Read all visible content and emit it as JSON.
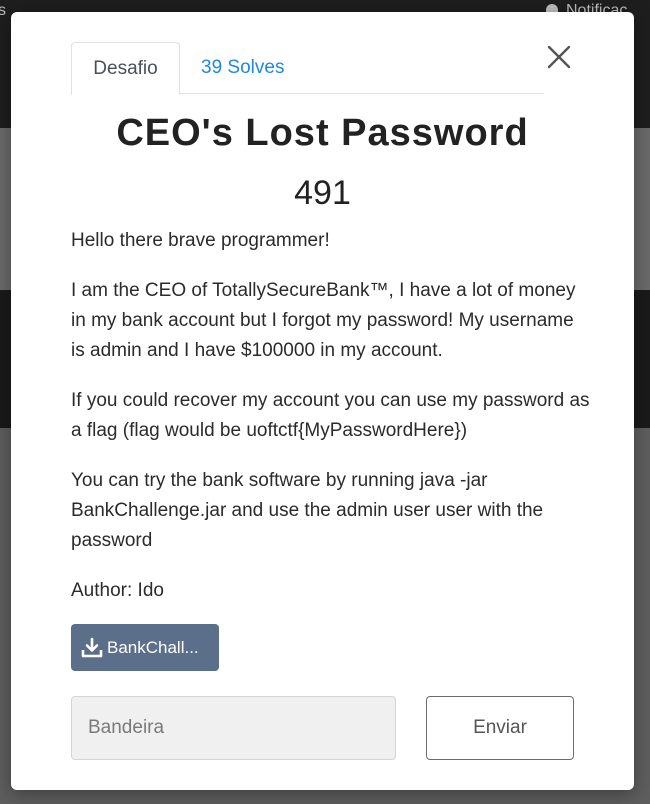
{
  "background": {
    "nav_left": "s",
    "nav_right": "Notificaç"
  },
  "modal": {
    "tabs": [
      {
        "label": "Desafio"
      },
      {
        "label": "39 Solves"
      }
    ],
    "title": "CEO's Lost Password",
    "points": "491",
    "description": [
      "Hello there brave programmer!",
      "I am the CEO of TotallySecureBank™, I have a lot of money in my bank account but I forgot my password! My username is admin and I have $100000 in my account.",
      "If you could recover my account you can use my password as a flag (flag would be uoftctf{MyPasswordHere})",
      "You can try the bank software by running java -jar BankChallenge.jar and use the admin user user with the password",
      "Author: Ido"
    ],
    "file_button": {
      "label": "BankChall...",
      "icon": "download-icon"
    },
    "flag_input": {
      "placeholder": "Bandeira",
      "value": ""
    },
    "submit_label": "Enviar"
  },
  "colors": {
    "accent_link": "#1e88e5",
    "file_button": "#5b6f8a"
  }
}
